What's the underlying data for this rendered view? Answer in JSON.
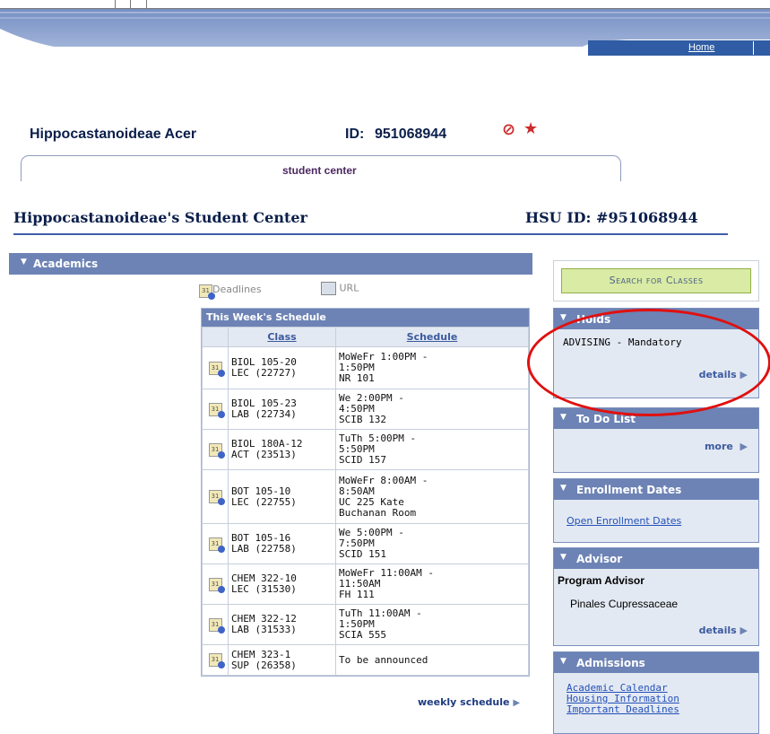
{
  "nav": {
    "home_label": "Home"
  },
  "student": {
    "name": "Hippocastanoideae Acer",
    "id_label": "ID:",
    "id_value": "951068944"
  },
  "tab": {
    "label": "student center"
  },
  "page": {
    "title": "Hippocastanoideae's Student Center",
    "hsu_id": "HSU ID: #951068944"
  },
  "academics": {
    "header": "Academics",
    "deadlines_label": "Deadlines",
    "url_label": "URL",
    "schedule_title": "This Week's Schedule",
    "col_class": "Class",
    "col_schedule": "Schedule",
    "rows": [
      {
        "class1": "BIOL 105-20",
        "class2": "LEC (22727)",
        "s1": "MoWeFr 1:00PM -",
        "s2": "1:50PM",
        "s3": "NR 101",
        "s4": ""
      },
      {
        "class1": "BIOL 105-23",
        "class2": "LAB (22734)",
        "s1": "We 2:00PM -",
        "s2": "4:50PM",
        "s3": "SCIB 132",
        "s4": ""
      },
      {
        "class1": "BIOL 180A-12",
        "class2": "ACT (23513)",
        "s1": "TuTh 5:00PM -",
        "s2": "5:50PM",
        "s3": "SCID 157",
        "s4": ""
      },
      {
        "class1": "BOT 105-10",
        "class2": "LEC (22755)",
        "s1": "MoWeFr 8:00AM -",
        "s2": "8:50AM",
        "s3": "UC 225 Kate",
        "s4": "Buchanan Room"
      },
      {
        "class1": "BOT 105-16",
        "class2": "LAB (22758)",
        "s1": "We 5:00PM -",
        "s2": "7:50PM",
        "s3": "SCID 151",
        "s4": ""
      },
      {
        "class1": "CHEM 322-10",
        "class2": "LEC (31530)",
        "s1": "MoWeFr 11:00AM -",
        "s2": "11:50AM",
        "s3": "FH 111",
        "s4": ""
      },
      {
        "class1": "CHEM 322-12",
        "class2": "LAB (31533)",
        "s1": "TuTh 11:00AM -",
        "s2": "1:50PM",
        "s3": "SCIA 555",
        "s4": ""
      },
      {
        "class1": "CHEM 323-1",
        "class2": "SUP (26358)",
        "s1": "To be announced",
        "s2": "",
        "s3": "",
        "s4": ""
      }
    ],
    "weekly_link": "weekly schedule"
  },
  "search": {
    "label": "Search for Classes"
  },
  "holds": {
    "header": "Holds",
    "item": "ADVISING - Mandatory",
    "details": "details"
  },
  "todo": {
    "header": "To Do List",
    "more": "more"
  },
  "enrollment": {
    "header": "Enrollment Dates",
    "link": "Open Enrollment Dates"
  },
  "advisor": {
    "header": "Advisor",
    "role": "Program Advisor",
    "name": "Pinales Cupressaceae",
    "details": "details"
  },
  "admissions": {
    "header": "Admissions",
    "links": [
      "Academic Calendar",
      "Housing Information",
      "Important Deadlines"
    ]
  },
  "colors": {
    "nav_blue": "#2f5ca4",
    "section_header": "#6d83b5",
    "panel_bg": "#e3e9f3",
    "annotation_red": "#e01010",
    "search_green": "#d9eba4"
  }
}
